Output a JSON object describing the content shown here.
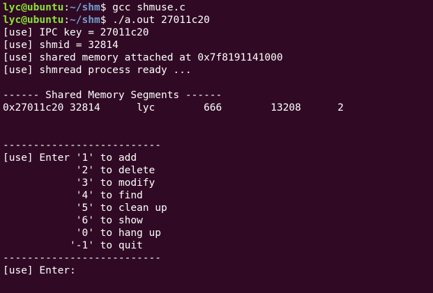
{
  "prompt": {
    "user_host": "lyc@ubuntu",
    "sep": ":",
    "path": "~/shm",
    "symbol": "$ "
  },
  "commands": [
    "gcc shmuse.c",
    "./a.out 27011c20"
  ],
  "output": [
    "[use] IPC key = 27011c20",
    "[use] shmid = 32814",
    "[use] shared memory attached at 0x7f8191141000",
    "[use] shmread process ready ...",
    "",
    "------ Shared Memory Segments ------",
    "0x27011c20 32814      lyc        666        13208      2",
    "",
    "",
    "--------------------------",
    "[use] Enter '1' to add",
    "            '2' to delete",
    "            '3' to modify",
    "            '4' to find",
    "            '5' to clean up",
    "            '6' to show",
    "            '0' to hang up",
    "           '-1' to quit",
    "--------------------------",
    "[use] Enter: "
  ],
  "colors": {
    "background": "#300a24",
    "text": "#ffffff",
    "user": "#8ae234",
    "path": "#729fcf"
  }
}
